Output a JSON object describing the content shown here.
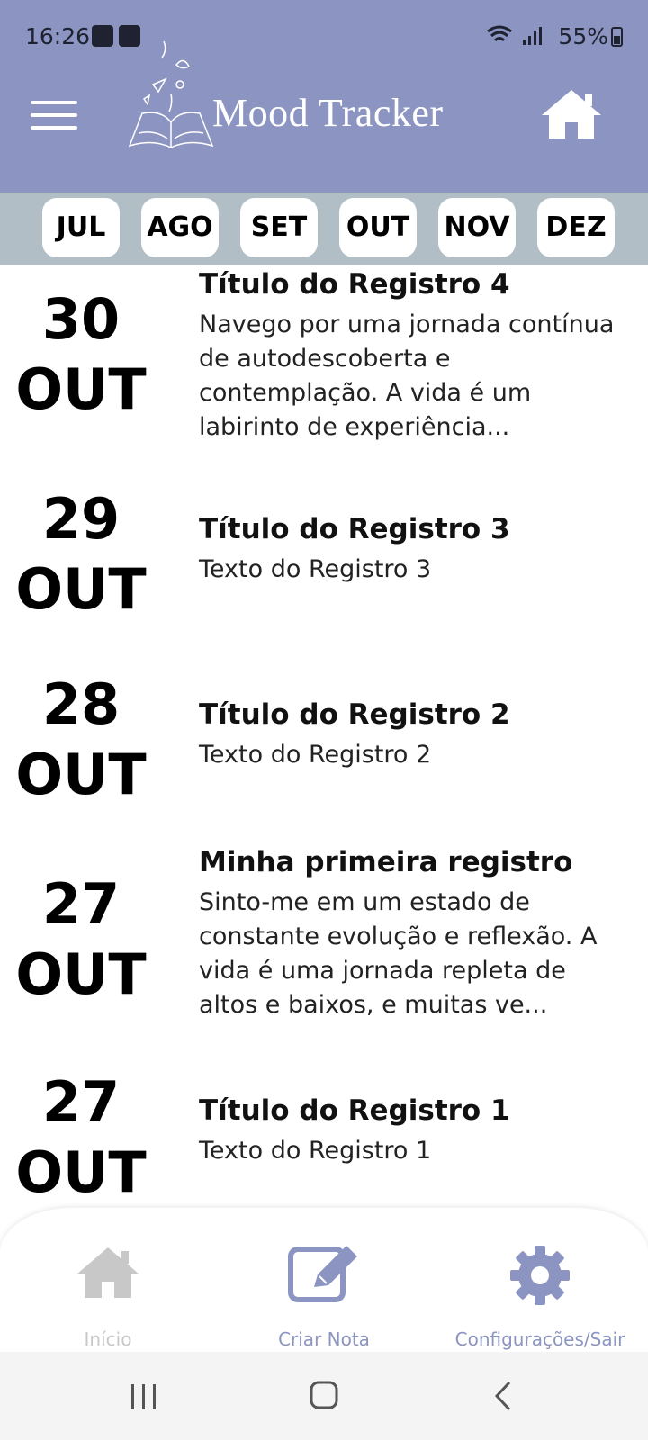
{
  "status_bar": {
    "time": "16:26",
    "battery": "55%"
  },
  "header": {
    "app_title": "Mood Tracker",
    "menu_icon": "hamburger-menu-icon",
    "home_icon": "home-icon",
    "logo_icon": "book-logo-icon",
    "background_color": "#8c95c2"
  },
  "months": [
    "JUL",
    "AGO",
    "SET",
    "OUT",
    "NOV",
    "DEZ"
  ],
  "entries": [
    {
      "day": "30",
      "month": "OUT",
      "title": "Título do Registro 4",
      "text": "Navego por uma jornada contínua de autodescoberta e contemplação. A vida é um labirinto de experiência..."
    },
    {
      "day": "29",
      "month": "OUT",
      "title": "Título do Registro 3",
      "text": "Texto do Registro 3"
    },
    {
      "day": "28",
      "month": "OUT",
      "title": "Título do Registro 2",
      "text": "Texto do Registro 2"
    },
    {
      "day": "27",
      "month": "OUT",
      "title": "Minha primeira registro",
      "text": "Sinto-me em um estado de constante evolução e reflexão. A vida é uma jornada repleta de altos e baixos, e muitas ve..."
    },
    {
      "day": "27",
      "month": "OUT",
      "title": "Título do Registro 1",
      "text": "Texto do Registro 1"
    }
  ],
  "bottom_nav": {
    "home_label": "Início",
    "create_label": "Criar Nota",
    "settings_label": "Configurações/Sair",
    "active_color": "#8c95c2",
    "inactive_color": "#c8c8c8"
  }
}
